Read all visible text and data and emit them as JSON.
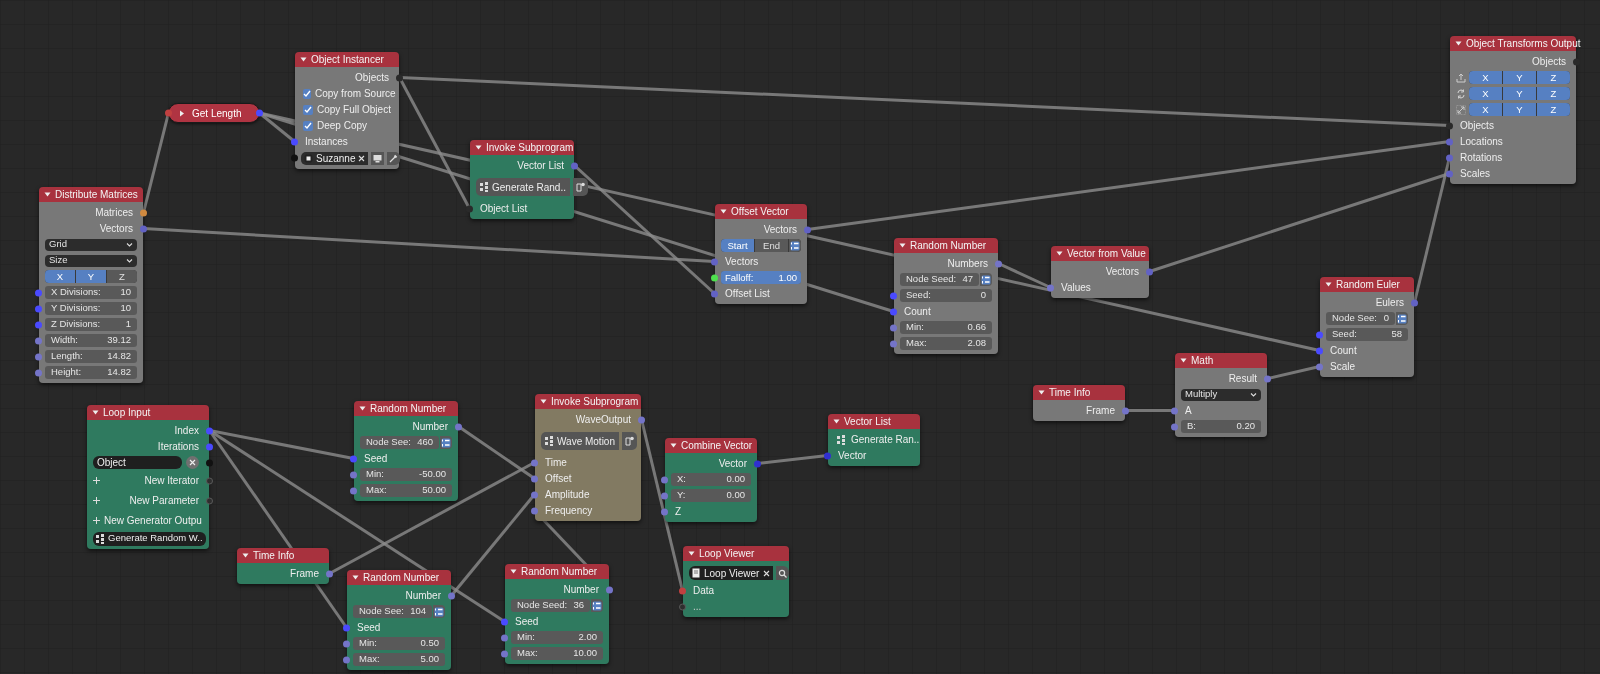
{
  "nodes": [
    {
      "title": "Object Instancer",
      "color": "#787878",
      "collapsed": false,
      "rows": [
        {
          "kind": "output",
          "label": "Objects",
          "color": "#2a2a2a"
        },
        {
          "kind": "checkbox",
          "label": "Copy from Source",
          "checked": true
        },
        {
          "kind": "checkbox",
          "label": "Copy Full Object",
          "checked": true
        },
        {
          "kind": "checkbox",
          "label": "Deep Copy",
          "checked": true
        },
        {
          "kind": "input",
          "label": "Instances",
          "color": "#4a4aff"
        },
        {
          "kind": "object",
          "label": "Suzanne",
          "color": "#111111"
        }
      ]
    },
    {
      "title": "Get Length",
      "color": "#b03442",
      "collapsed": true,
      "rows": [
        {
          "kind": "socket_in",
          "color": "#c04040"
        },
        {
          "kind": "socket_out",
          "color": "#4a4aff"
        }
      ]
    },
    {
      "title": "Object Transforms Output",
      "color": "#787878",
      "collapsed": false,
      "rows": [
        {
          "kind": "output",
          "label": "Objects",
          "color": "#2a2a2a"
        },
        {
          "kind": "axes",
          "options": [
            {
              "label": "X",
              "selected": true
            },
            {
              "label": "Y",
              "selected": true
            },
            {
              "label": "Z",
              "selected": true
            }
          ]
        },
        {
          "kind": "axes",
          "options": [
            {
              "label": "X",
              "selected": true
            },
            {
              "label": "Y",
              "selected": true
            },
            {
              "label": "Z",
              "selected": true
            }
          ]
        },
        {
          "kind": "axes",
          "options": [
            {
              "label": "X",
              "selected": true
            },
            {
              "label": "Y",
              "selected": true
            },
            {
              "label": "Z",
              "selected": true
            }
          ]
        },
        {
          "kind": "input",
          "label": "Objects",
          "color": "#2a2a2a"
        },
        {
          "kind": "input",
          "label": "Locations",
          "color": "#6262c4"
        },
        {
          "kind": "input",
          "label": "Rotations",
          "color": "#6262c4"
        },
        {
          "kind": "input",
          "label": "Scales",
          "color": "#6262c4"
        }
      ]
    },
    {
      "title": "Invoke Subprogram",
      "color": "#2f7a5f",
      "collapsed": false,
      "rows": [
        {
          "kind": "output",
          "label": "Vector List",
          "color": "#6262c4"
        },
        {
          "kind": "subprogram",
          "label": "Generate Rand.."
        },
        {
          "kind": "input",
          "label": "Object List",
          "color": "#2a2a2a"
        }
      ]
    },
    {
      "title": "Distribute Matrices",
      "color": "#787878",
      "collapsed": false,
      "rows": [
        {
          "kind": "output",
          "label": "Matrices",
          "color": "#d08a40"
        },
        {
          "kind": "output",
          "label": "Vectors",
          "color": "#6262c4"
        },
        {
          "kind": "dropdown",
          "value": "Grid"
        },
        {
          "kind": "dropdown",
          "value": "Size"
        },
        {
          "kind": "toggle",
          "options": [
            {
              "label": "X",
              "selected": true
            },
            {
              "label": "Y",
              "selected": true
            },
            {
              "label": "Z",
              "selected": false
            }
          ]
        },
        {
          "kind": "field",
          "label": "X Divisions:",
          "value": "10",
          "color": "#4a4aff"
        },
        {
          "kind": "field",
          "label": "Y Divisions:",
          "value": "10",
          "color": "#4a4aff"
        },
        {
          "kind": "field",
          "label": "Z Divisions:",
          "value": "1",
          "color": "#4a4aff"
        },
        {
          "kind": "field",
          "label": "Width:",
          "value": "39.12",
          "color": "#7474c8"
        },
        {
          "kind": "field",
          "label": "Length:",
          "value": "14.82",
          "color": "#7474c8"
        },
        {
          "kind": "field",
          "label": "Height:",
          "value": "14.82",
          "color": "#7474c8"
        }
      ]
    },
    {
      "title": "Offset Vector",
      "color": "#787878",
      "collapsed": false,
      "rows": [
        {
          "kind": "output",
          "label": "Vectors",
          "color": "#6262c4"
        },
        {
          "kind": "toggle_list",
          "options": [
            {
              "label": "Start",
              "selected": true
            },
            {
              "label": "End",
              "selected": false
            }
          ]
        },
        {
          "kind": "input",
          "label": "Vectors",
          "color": "#6262c4"
        },
        {
          "kind": "slider",
          "label": "Falloff:",
          "value": "1.00",
          "level": 1,
          "color": "#4ee04e"
        },
        {
          "kind": "input",
          "label": "Offset List",
          "color": "#6262c4"
        }
      ]
    },
    {
      "title": "Random Number",
      "color": "#787878",
      "collapsed": false,
      "rows": [
        {
          "kind": "output",
          "label": "Numbers",
          "color": "#7474c8"
        },
        {
          "kind": "seed",
          "label": "Node Seed:",
          "value": "47"
        },
        {
          "kind": "field",
          "label": "Seed:",
          "value": "0",
          "color": "#4a4aff"
        },
        {
          "kind": "input",
          "label": "Count",
          "color": "#4a4aff"
        },
        {
          "kind": "field",
          "label": "Min:",
          "value": "0.66",
          "color": "#7474c8"
        },
        {
          "kind": "field",
          "label": "Max:",
          "value": "2.08",
          "color": "#7474c8"
        }
      ]
    },
    {
      "title": "Vector from Value",
      "color": "#787878",
      "collapsed": false,
      "rows": [
        {
          "kind": "output",
          "label": "Vectors",
          "color": "#6262c4"
        },
        {
          "kind": "input",
          "label": "Values",
          "color": "#7474c8"
        }
      ]
    },
    {
      "title": "Random Euler",
      "color": "#787878",
      "collapsed": false,
      "rows": [
        {
          "kind": "output",
          "label": "Eulers",
          "color": "#6262c4"
        },
        {
          "kind": "seed",
          "label": "Node See:",
          "value": "0"
        },
        {
          "kind": "field",
          "label": "Seed:",
          "value": "58",
          "color": "#4a4aff"
        },
        {
          "kind": "input",
          "label": "Count",
          "color": "#4a4aff"
        },
        {
          "kind": "input",
          "label": "Scale",
          "color": "#7474c8"
        }
      ]
    },
    {
      "title": "Math",
      "color": "#787878",
      "collapsed": false,
      "rows": [
        {
          "kind": "output",
          "label": "Result",
          "color": "#7474c8"
        },
        {
          "kind": "dropdown",
          "value": "Multiply"
        },
        {
          "kind": "input",
          "label": "A",
          "color": "#7474c8"
        },
        {
          "kind": "field",
          "label": "B:",
          "value": "0.20",
          "color": "#7474c8"
        }
      ]
    },
    {
      "title": "Time Info",
      "color": "#787878",
      "collapsed": false,
      "rows": [
        {
          "kind": "output",
          "label": "Frame",
          "color": "#7474c8"
        }
      ]
    },
    {
      "title": "Loop Input",
      "color": "#2f7a5f",
      "collapsed": false,
      "rows": [
        {
          "kind": "output",
          "label": "Index",
          "color": "#4a4aff"
        },
        {
          "kind": "output",
          "label": "Iterations",
          "color": "#4a4aff"
        },
        {
          "kind": "text_input",
          "value": "Object",
          "color": "#111111"
        },
        {
          "kind": "add",
          "label": "New Iterator",
          "color": "#5a5a5a"
        },
        {
          "kind": "add",
          "label": "New Parameter",
          "color": "#5a5a5a"
        },
        {
          "kind": "add",
          "label": "New Generator Outpu"
        },
        {
          "kind": "generator",
          "label": "Generate Random W.."
        }
      ]
    },
    {
      "title": "Random Number",
      "color": "#2f7a5f",
      "collapsed": false,
      "rows": [
        {
          "kind": "output",
          "label": "Number",
          "color": "#7474c8"
        },
        {
          "kind": "seed",
          "label": "Node See:",
          "value": "460"
        },
        {
          "kind": "input",
          "label": "Seed",
          "color": "#4a4aff"
        },
        {
          "kind": "field",
          "label": "Min:",
          "value": "-50.00",
          "color": "#7474c8"
        },
        {
          "kind": "field",
          "label": "Max:",
          "value": "50.00",
          "color": "#7474c8"
        }
      ]
    },
    {
      "title": "Invoke Subprogram",
      "color": "#827a62",
      "collapsed": false,
      "rows": [
        {
          "kind": "output",
          "label": "WaveOutput",
          "color": "#7474c8"
        },
        {
          "kind": "subprogram",
          "label": "Wave Motion"
        },
        {
          "kind": "input",
          "label": "Time",
          "color": "#7474c8"
        },
        {
          "kind": "input",
          "label": "Offset",
          "color": "#7474c8"
        },
        {
          "kind": "input",
          "label": "Amplitude",
          "color": "#7474c8"
        },
        {
          "kind": "input",
          "label": "Frequency",
          "color": "#7474c8"
        }
      ]
    },
    {
      "title": "Vector List",
      "color": "#2f7a5f",
      "collapsed": false,
      "rows": [
        {
          "kind": "generator_plain",
          "label": "Generate Ran.."
        },
        {
          "kind": "input",
          "label": "Vector",
          "color": "#3030d0"
        }
      ]
    },
    {
      "title": "Combine Vector",
      "color": "#2f7a5f",
      "collapsed": false,
      "rows": [
        {
          "kind": "output",
          "label": "Vector",
          "color": "#3030d0"
        },
        {
          "kind": "field",
          "label": "X:",
          "value": "0.00",
          "color": "#7474c8"
        },
        {
          "kind": "field",
          "label": "Y:",
          "value": "0.00",
          "color": "#7474c8"
        },
        {
          "kind": "input",
          "label": "Z",
          "color": "#7474c8"
        }
      ]
    },
    {
      "title": "Time Info",
      "color": "#2f7a5f",
      "collapsed": false,
      "rows": [
        {
          "kind": "output",
          "label": "Frame",
          "color": "#7474c8"
        }
      ]
    },
    {
      "title": "Random Number",
      "color": "#2f7a5f",
      "collapsed": false,
      "rows": [
        {
          "kind": "output",
          "label": "Number",
          "color": "#7474c8"
        },
        {
          "kind": "seed",
          "label": "Node See:",
          "value": "104"
        },
        {
          "kind": "input",
          "label": "Seed",
          "color": "#4a4aff"
        },
        {
          "kind": "field",
          "label": "Min:",
          "value": "0.50",
          "color": "#7474c8"
        },
        {
          "kind": "field",
          "label": "Max:",
          "value": "5.00",
          "color": "#7474c8"
        }
      ]
    },
    {
      "title": "Random Number",
      "color": "#2f7a5f",
      "collapsed": false,
      "rows": [
        {
          "kind": "output",
          "label": "Number",
          "color": "#7474c8"
        },
        {
          "kind": "seed",
          "label": "Node Seed:",
          "value": "36"
        },
        {
          "kind": "input",
          "label": "Seed",
          "color": "#4a4aff"
        },
        {
          "kind": "field",
          "label": "Min:",
          "value": "2.00",
          "color": "#7474c8"
        },
        {
          "kind": "field",
          "label": "Max:",
          "value": "10.00",
          "color": "#7474c8"
        }
      ]
    },
    {
      "title": "Loop Viewer",
      "color": "#2f7a5f",
      "collapsed": false,
      "rows": [
        {
          "kind": "viewer",
          "label": "Loop Viewer"
        },
        {
          "kind": "input",
          "label": "Data",
          "color": "#c04040"
        },
        {
          "kind": "placeholder_input",
          "label": "...",
          "color": "#5a5a5a"
        }
      ]
    }
  ]
}
